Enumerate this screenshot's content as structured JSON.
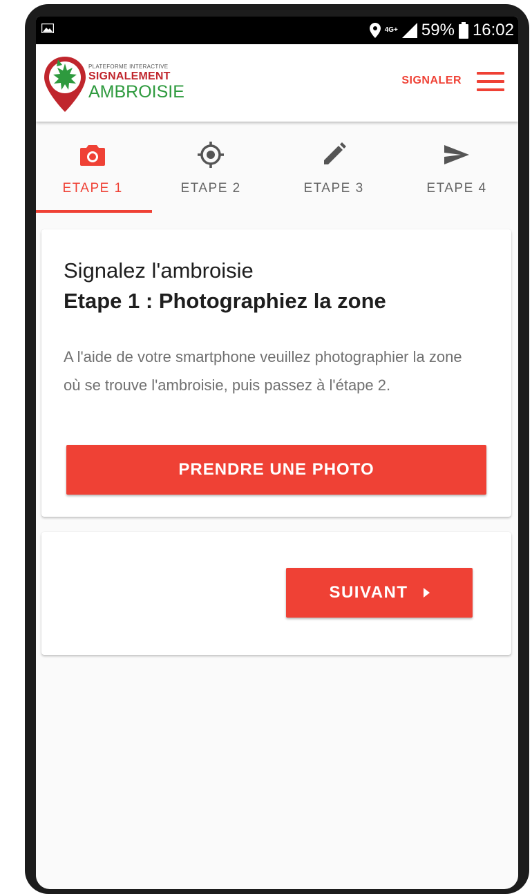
{
  "status_bar": {
    "network": "4G+",
    "battery": "59%",
    "time": "16:02"
  },
  "header": {
    "logo_line1": "PLATEFORME INTERACTIVE",
    "logo_line2": "SIGNALEMENT",
    "logo_line3": "AMBROISIE",
    "signaler_label": "SIGNALER",
    "menu_icon": "hamburger-menu-icon"
  },
  "tabs": [
    {
      "label": "ETAPE 1",
      "icon": "camera-icon",
      "active": true
    },
    {
      "label": "ETAPE 2",
      "icon": "gps-target-icon",
      "active": false
    },
    {
      "label": "ETAPE 3",
      "icon": "pencil-icon",
      "active": false
    },
    {
      "label": "ETAPE 4",
      "icon": "send-icon",
      "active": false
    }
  ],
  "step_card": {
    "title": "Signalez l'ambroisie",
    "subtitle": "Etape 1 : Photographiez la zone",
    "body": "A l'aide de votre smartphone veuillez photographier la zone où se trouve l'ambroisie, puis passez à l'étape 2.",
    "photo_button": "PRENDRE UNE PHOTO"
  },
  "nav_card": {
    "next_button": "SUIVANT"
  },
  "colors": {
    "accent": "#ef4135",
    "logo_green": "#2e9a3e",
    "logo_red": "#c0262d"
  }
}
